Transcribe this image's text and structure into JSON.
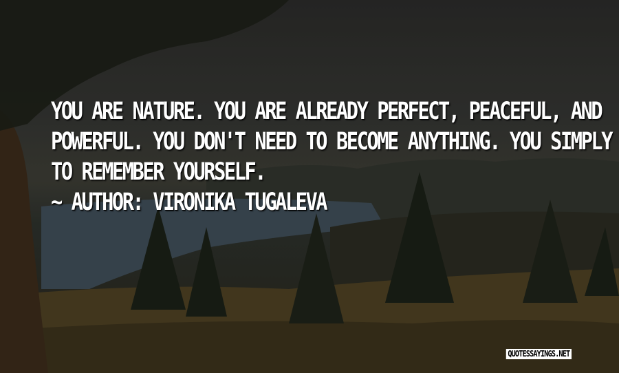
{
  "quote": {
    "lines": [
      "YOU ARE NATURE. YOU ARE ALREADY PERFECT, PEACEFUL, AND",
      "POWERFUL. YOU DON'T NEED TO BECOME ANYTHING. YOU SIMPLY NEED",
      "TO REMEMBER YOURSELF."
    ],
    "author_line": "~ AUTHOR: VIRONIKA TUGALEVA"
  },
  "watermark": "QUOTESSAYINGS.NET",
  "colors": {
    "text": "#ffffff",
    "sky": "#323330",
    "lake": "#3d4a55",
    "trees": "#1a1f16",
    "meadow": "#4a3e22"
  }
}
